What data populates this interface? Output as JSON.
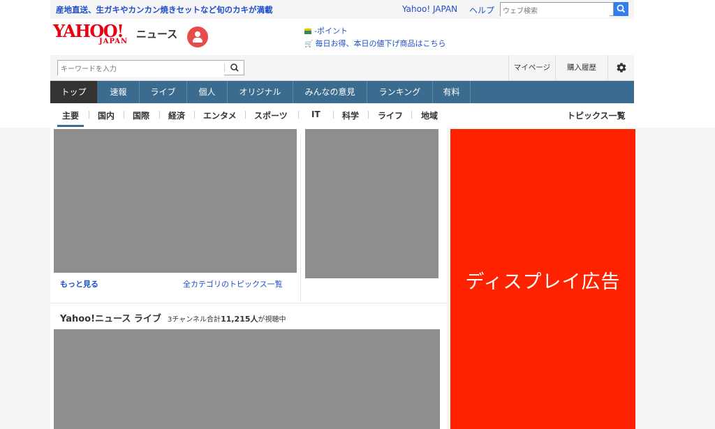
{
  "promo": {
    "text": "産地直送、生ガキやカンカン焼きセットなど旬のカキが満載"
  },
  "top_links": {
    "yahoo_japan": "Yahoo! JAPAN",
    "help": "ヘルプ"
  },
  "web_search": {
    "placeholder": "ウェブ検索"
  },
  "logo": {
    "yahoo": "YAHOO!",
    "japan": "JAPAN",
    "news": "ニュース"
  },
  "promo_links": {
    "point": "-ポイント",
    "deal": "毎日お得、本日の値下げ商品はこちら"
  },
  "keyword_search": {
    "placeholder": "キーワードを入力"
  },
  "subbar": {
    "mypage": "マイページ",
    "history": "購入履歴"
  },
  "global_nav": [
    "トップ",
    "速報",
    "ライブ",
    "個人",
    "オリジナル",
    "みんなの意見",
    "ランキング",
    "有料"
  ],
  "category_nav": [
    "主要",
    "国内",
    "国際",
    "経済",
    "エンタメ",
    "スポーツ",
    "IT",
    "科学",
    "ライフ",
    "地域"
  ],
  "topics_list_link": "トピックス一覧",
  "topics": {
    "more": "もっと見る",
    "all_categories": "全カテゴリのトピックス一覧"
  },
  "live": {
    "title": "Yahoo!ニュース ライブ",
    "meta_prefix": "3チャンネル合計",
    "viewer_count": "11,215人",
    "meta_suffix": "が視聴中"
  },
  "ad": {
    "label": "ディスプレイ広告"
  },
  "colors": {
    "brand_red": "#e60012",
    "nav_blue": "#3b6b8e",
    "link_blue": "#1e4ec8",
    "ad_red": "#ff2200"
  }
}
